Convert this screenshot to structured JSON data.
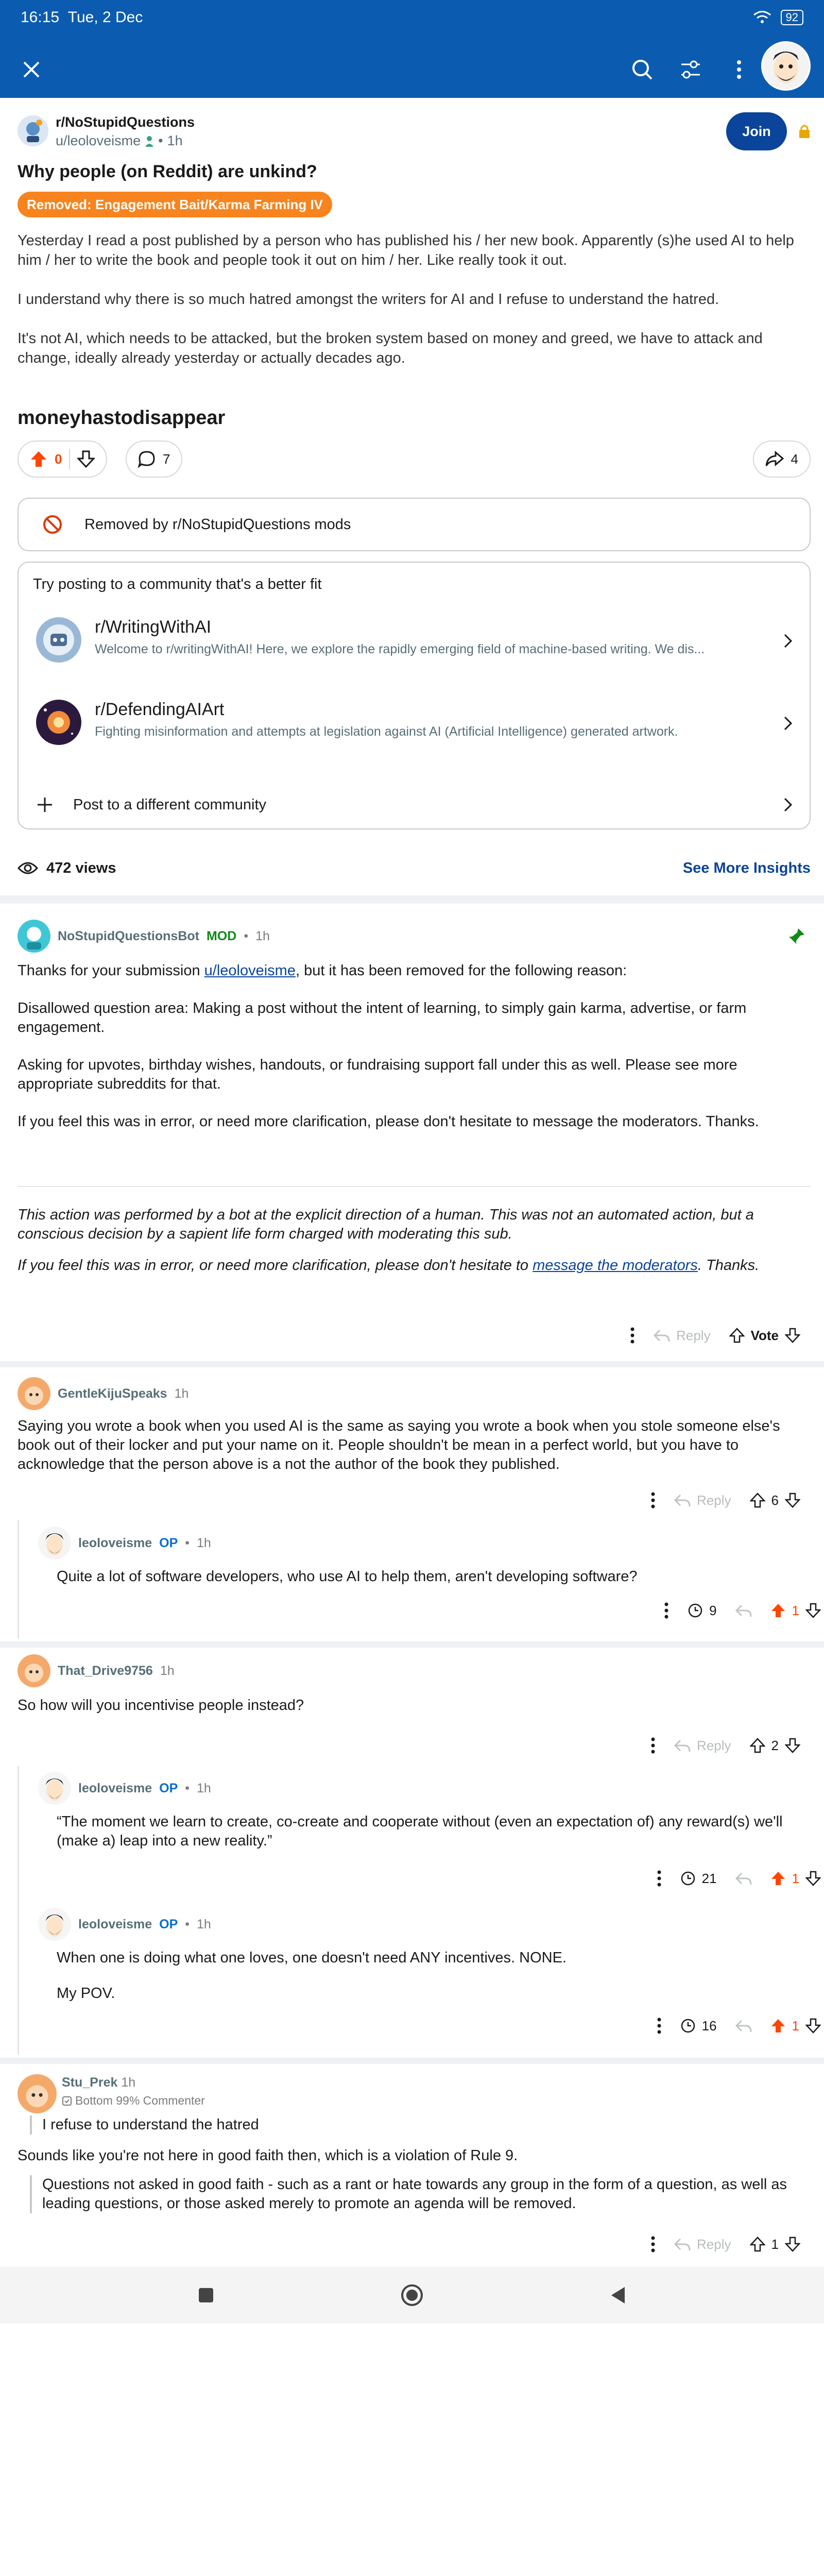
{
  "status": {
    "time": "16:15",
    "date": "Tue, 2 Dec",
    "battery": "92"
  },
  "post": {
    "subreddit": "r/NoStupidQuestions",
    "author": "u/leoloveisme",
    "time": "1h",
    "join_label": "Join",
    "title": "Why people (on Reddit) are unkind?",
    "flair": "Removed: Engagement Bait/Karma Farming IV",
    "body": [
      "Yesterday I read a post published by a person who has published his / her new book. Apparently (s)he used AI to help him / her to write the book and people took it out on him / her. Like really took it out.",
      "I understand why there is so much hatred amongst the writers for AI and I refuse to understand the hatred.",
      "It's not AI, which needs to be attacked, but the broken system based on money and greed, we have to attack and change, ideally already yesterday or actually decades ago."
    ],
    "signature": "moneyhastodisappear",
    "votes": "0",
    "comments": "7",
    "shares": "4",
    "removed_notice": "Removed by r/NoStupidQuestions mods",
    "suggest_title": "Try posting to a community that's a better fit",
    "communities": [
      {
        "name": "r/WritingWithAI",
        "desc": "Welcome to r/writingWithAI! Here, we explore the rapidly emerging field of machine-based writing. We dis..."
      },
      {
        "name": "r/DefendingAIArt",
        "desc": "Fighting misinformation and attempts at legislation against AI (Artificial Intelligence) generated artwork."
      }
    ],
    "post_different": "Post to a different community",
    "views": "472 views",
    "insights": "See More Insights"
  },
  "comments": {
    "bot": {
      "user": "NoStupidQuestionsBot",
      "badge": "MOD",
      "time": "1h",
      "p1_pre": "Thanks for your submission ",
      "p1_link": "u/leoloveisme",
      "p1_post": ", but it has been removed for the following reason:",
      "p2": "Disallowed question area: Making a post without the intent of learning, to simply gain karma, advertise, or farm engagement.",
      "p3": "Asking for upvotes, birthday wishes, handouts, or fundraising support fall under this as well. Please see more appropriate subreddits for that.",
      "p4": "If you feel this was in error, or need more clarification, please don't hesitate to message the moderators. Thanks.",
      "i1": "This action was performed by a bot at the explicit direction of a human. This was not an automated action, but a conscious decision by a sapient life form charged with moderating this sub.",
      "i2_pre": "If you feel this was in error, or need more clarification, please don't hesitate to ",
      "i2_link": "message the moderators",
      "i2_post": ". Thanks.",
      "reply": "Reply",
      "vote": "Vote"
    },
    "c1": {
      "user": "GentleKijuSpeaks",
      "time": "1h",
      "text": "Saying you wrote a book when you used AI is the same as saying you wrote a book when you stole someone else's book out of their locker and put your name on it. People shouldn't be mean in a perfect world, but you have to acknowledge that the person above is a not the author of the book they published.",
      "reply": "Reply",
      "votes": "6"
    },
    "c1r": {
      "user": "leoloveisme",
      "badge": "OP",
      "time": "1h",
      "text": "Quite a lot of software developers, who use AI to help them, aren't developing software?",
      "views": "9",
      "votes": "1"
    },
    "c2": {
      "user": "That_Drive9756",
      "time": "1h",
      "text": "So how will you incentivise people instead?",
      "reply": "Reply",
      "votes": "2"
    },
    "c2r1": {
      "user": "leoloveisme",
      "badge": "OP",
      "time": "1h",
      "text": "“The moment we learn to create, co-create and cooperate without (even an expectation of) any reward(s) we'll (make a) leap into a new reality.”",
      "views": "21",
      "votes": "1"
    },
    "c2r2": {
      "user": "leoloveisme",
      "badge": "OP",
      "time": "1h",
      "text1": "When one is doing what one loves, one doesn't need ANY incentives. NONE.",
      "text2": "My POV.",
      "views": "16",
      "votes": "1"
    },
    "c3": {
      "user": "Stu_Prek",
      "time": "1h",
      "flair": "Bottom 99% Commenter",
      "quote": "I refuse to understand the hatred",
      "text": "Sounds like you're not here in good faith then, which is a violation of Rule 9.",
      "quote2": "Questions not asked in good faith - such as a rant or hate towards any group in the form of a question, as well as leading questions, or those asked merely to promote an agenda will be removed.",
      "reply": "Reply",
      "votes": "1"
    }
  },
  "colors": {
    "brand": "#0b5cb0",
    "join": "#0a449b",
    "upvote": "#ff4500",
    "flair": "#f7841e",
    "mod": "#0e8a16"
  }
}
